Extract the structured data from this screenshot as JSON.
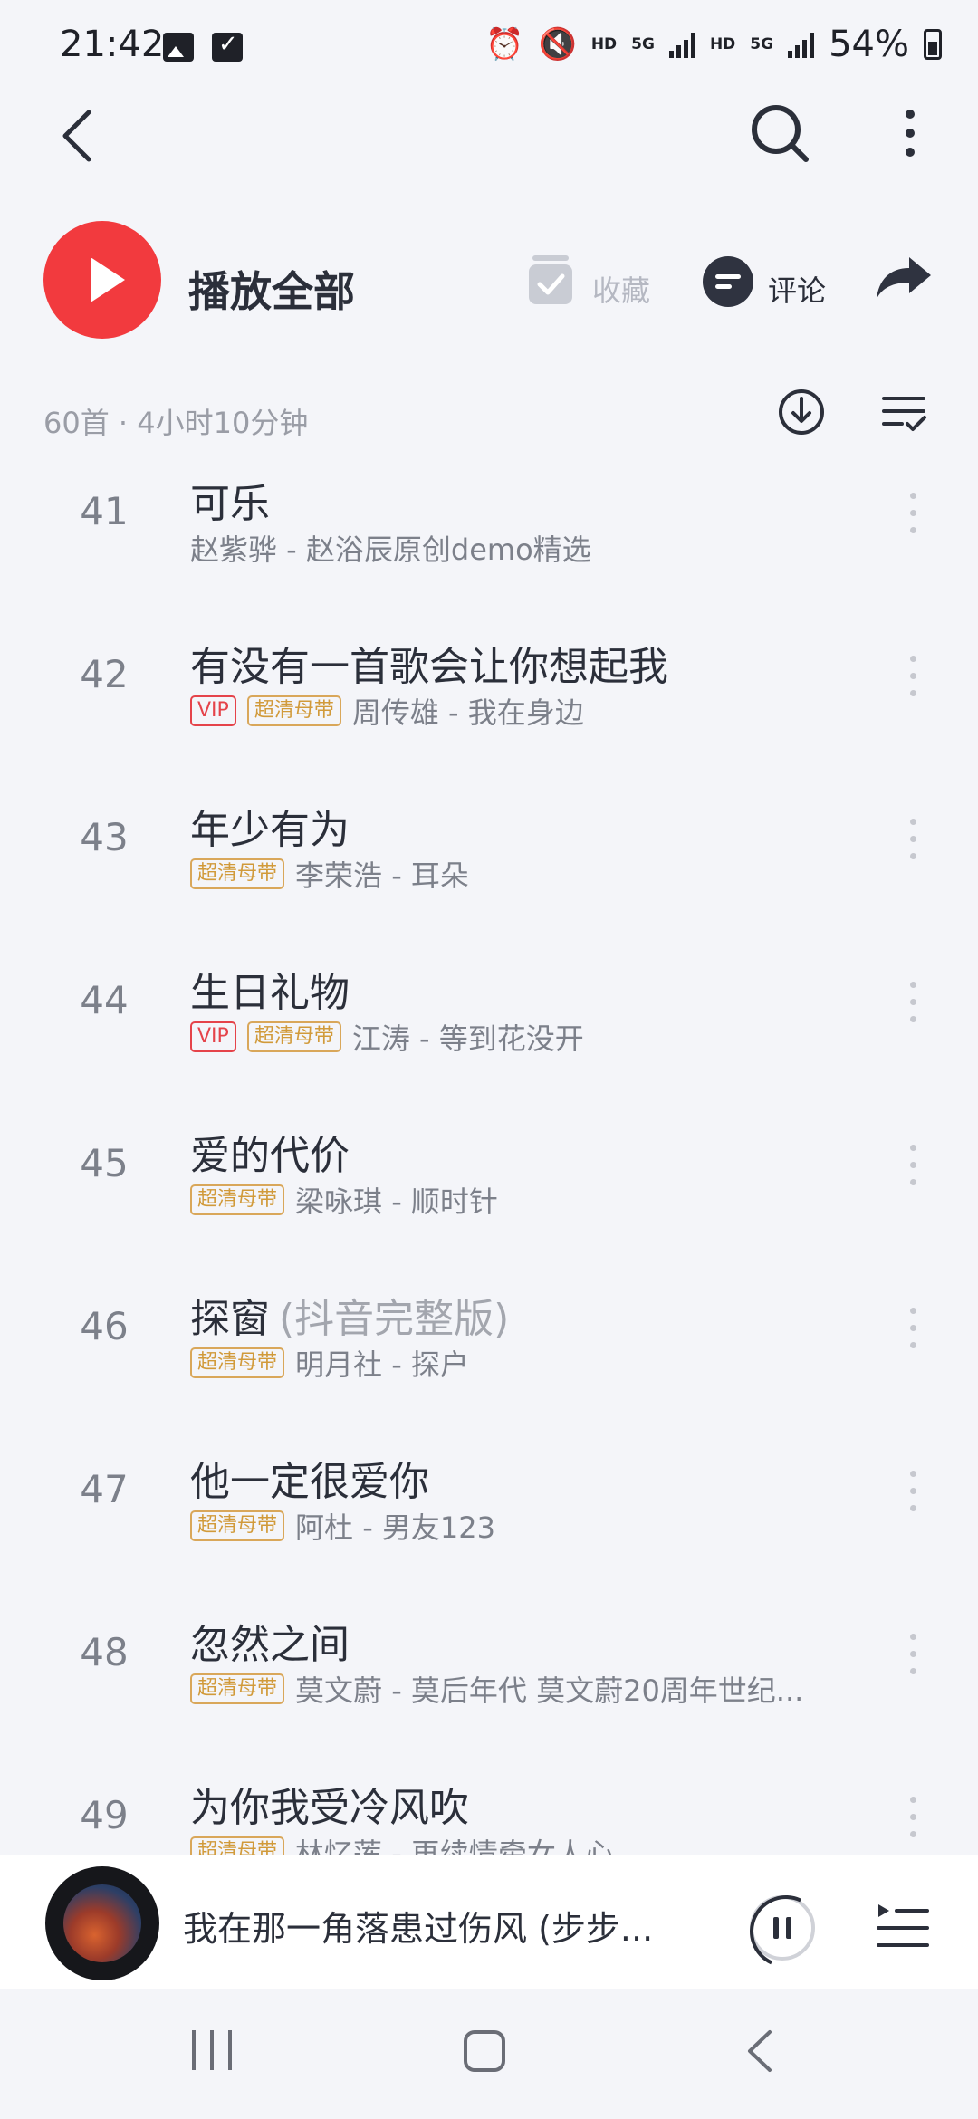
{
  "status_bar": {
    "time": "21:42",
    "network_labels": [
      "HD",
      "5G",
      "HD",
      "5G"
    ],
    "battery_percent": "54%",
    "battery_level": 0.54
  },
  "header": {
    "play_all_label": "播放全部",
    "collect_label": "收藏",
    "comment_label": "评论",
    "summary": "60首 · 4小时10分钟"
  },
  "songs": [
    {
      "index": "41",
      "title": "可乐",
      "title_suffix": "",
      "artist": "赵紫骅 - 赵浴辰原创demo精选",
      "badges": []
    },
    {
      "index": "42",
      "title": "有没有一首歌会让你想起我",
      "title_suffix": "",
      "artist": "周传雄 - 我在身边",
      "badges": [
        "VIP",
        "超清母带"
      ]
    },
    {
      "index": "43",
      "title": "年少有为",
      "title_suffix": "",
      "artist": "李荣浩 - 耳朵",
      "badges": [
        "超清母带"
      ]
    },
    {
      "index": "44",
      "title": "生日礼物",
      "title_suffix": "",
      "artist": "江涛 - 等到花没开",
      "badges": [
        "VIP",
        "超清母带"
      ]
    },
    {
      "index": "45",
      "title": "爱的代价",
      "title_suffix": "",
      "artist": "梁咏琪 - 顺时针",
      "badges": [
        "超清母带"
      ]
    },
    {
      "index": "46",
      "title": "探窗",
      "title_suffix": "(抖音完整版)",
      "artist": "明月社 - 探户",
      "badges": [
        "超清母带"
      ]
    },
    {
      "index": "47",
      "title": "他一定很爱你",
      "title_suffix": "",
      "artist": "阿杜 - 男友123",
      "badges": [
        "超清母带"
      ]
    },
    {
      "index": "48",
      "title": "忽然之间",
      "title_suffix": "",
      "artist": "莫文蔚 - 莫后年代 莫文蔚20周年世纪...",
      "badges": [
        "超清母带"
      ]
    },
    {
      "index": "49",
      "title": "为你我受冷风吹",
      "title_suffix": "",
      "artist": "林忆莲 - 再续情牵女人心",
      "badges": [
        "超清母带"
      ]
    }
  ],
  "mini_player": {
    "title": "我在那一角落患过伤风 (步步..."
  },
  "colors": {
    "accent_red": "#f23a3e",
    "vip_red": "#e5434a",
    "hq_gold": "#d19a3a",
    "background": "#f4f5f9"
  },
  "icons": [
    "back-icon",
    "search-icon",
    "more-icon",
    "play-icon",
    "collect-icon",
    "comment-icon",
    "share-icon",
    "download-icon",
    "multiselect-icon",
    "pause-icon",
    "playlist-icon"
  ]
}
